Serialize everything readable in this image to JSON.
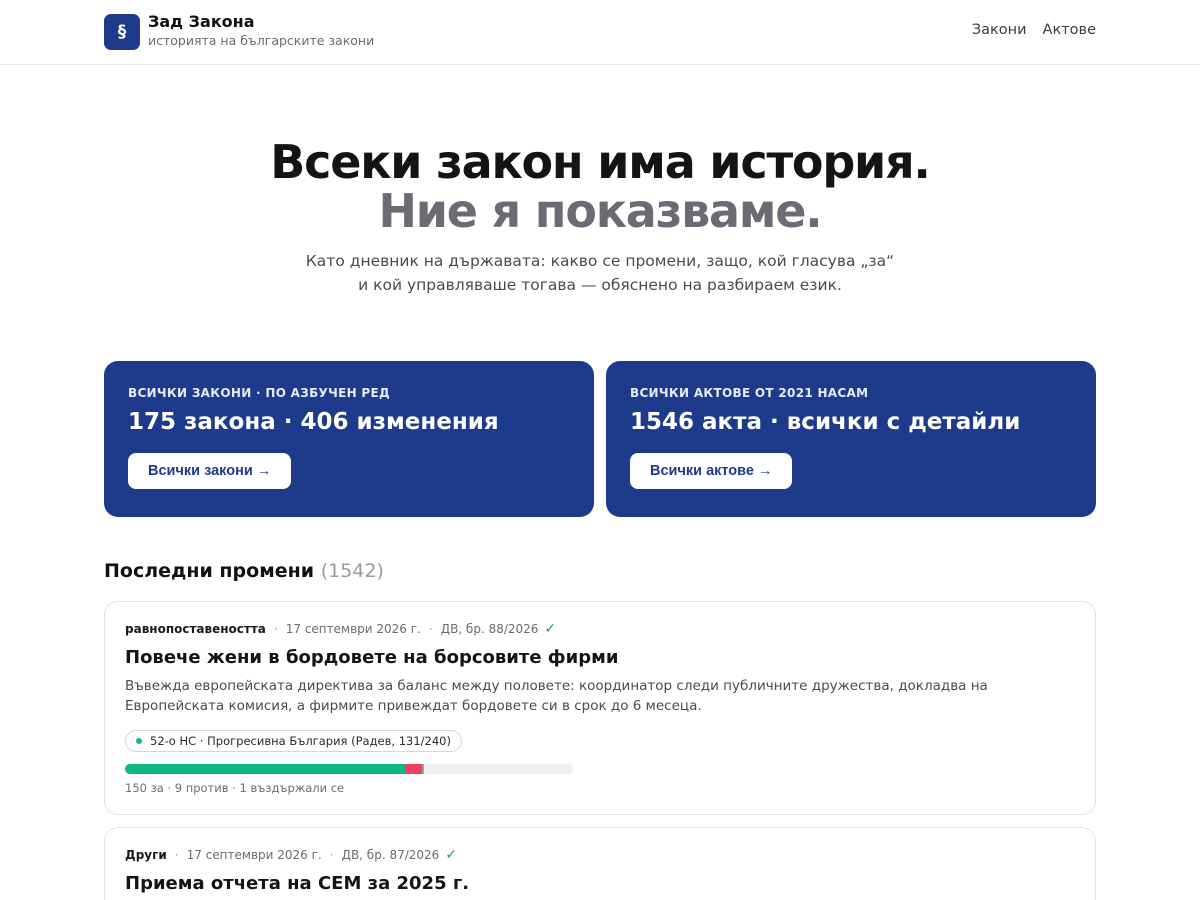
{
  "brand": {
    "logo_symbol": "§",
    "title": "Зад Закона",
    "subtitle": "историята на българските закони"
  },
  "nav": [
    {
      "label": "Закони"
    },
    {
      "label": "Актове"
    }
  ],
  "hero": {
    "line1": "Всеки закон има история.",
    "line2": "Ние я показваме.",
    "description": "Като дневник на държавата: какво се промени, защо, кой гласува „за“ и кой управляваше тогава — обяснено на разбираем език."
  },
  "cards": [
    {
      "kicker": "ВСИЧКИ ЗАКОНИ · ПО АЗБУЧЕН РЕД",
      "title": "175 закона · 406 изменения",
      "button": "Всички закони →"
    },
    {
      "kicker": "ВСИЧКИ АКТОВЕ ОТ 2021 НАСАМ",
      "title": "1546 акта · всички с детайли",
      "button": "Всички актове →"
    }
  ],
  "recent": {
    "title": "Последни промени",
    "count": "(1542)",
    "items": [
      {
        "category": "равнопоставеността",
        "date": "17 септември 2026 г.",
        "gazette": "ДВ, бр. 88/2026",
        "title": "Повече жени в бордовете на борсовите фирми",
        "description": "Въвежда европейската директива за баланс между половете: координатор следи публичните дружества, докладва на Европейската комисия, а фирмите привеждат бордовете си в срок до 6 месеца.",
        "parliament": "52-о НС · Прогресивна България (Радев, 131/240)",
        "votes": {
          "for": 150,
          "against": 9,
          "abstained": 1,
          "total_seats": 240
        },
        "vote_text": "150 за · 9 против · 1 въздържали се"
      },
      {
        "category": "Други",
        "date": "17 септември 2026 г.",
        "gazette": "ДВ, бр. 87/2026",
        "title": "Приема отчета на СЕМ за 2025 г."
      }
    ]
  },
  "colors": {
    "accent": "#1e3a8a",
    "vote_for": "#10b981",
    "vote_against": "#f43f5e",
    "vote_abstained": "#9ca3af",
    "verified": "#16a34a"
  },
  "icons": {
    "logo": "section-sign-icon",
    "verified": "check-icon",
    "dot": "status-dot-icon"
  }
}
